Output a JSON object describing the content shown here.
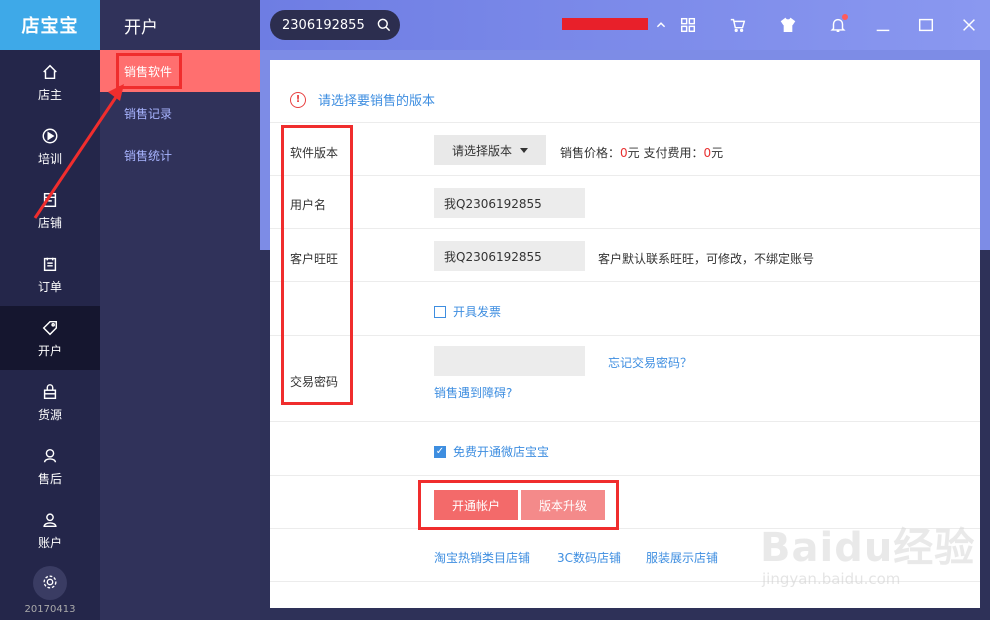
{
  "brand": "店宝宝",
  "rail": [
    {
      "label": "店主",
      "icon": "home-icon"
    },
    {
      "label": "培训",
      "icon": "play-icon"
    },
    {
      "label": "店铺",
      "icon": "store-icon"
    },
    {
      "label": "订单",
      "icon": "clipboard-icon"
    },
    {
      "label": "开户",
      "icon": "tag-icon"
    },
    {
      "label": "货源",
      "icon": "box-icon"
    },
    {
      "label": "售后",
      "icon": "headset-icon"
    },
    {
      "label": "账户",
      "icon": "user-icon"
    }
  ],
  "version": "20170413",
  "subnav": {
    "title": "开户",
    "items": [
      "销售软件",
      "销售记录",
      "销售统计"
    ]
  },
  "topbar": {
    "search_value": "2306192855",
    "icons": [
      "grid-icon",
      "cart-icon",
      "shirt-icon",
      "bell-icon",
      "minimize-icon",
      "maximize-icon",
      "close-icon"
    ]
  },
  "form": {
    "notice": "请选择要销售的版本",
    "version_label": "软件版本",
    "version_select": "请选择版本",
    "price_label": "销售价格：",
    "price_value": "0",
    "price_unit": "元",
    "pay_label": " 支付费用：",
    "pay_value": "0",
    "pay_unit": "元",
    "username_label": "用户名",
    "username_value": "我Q2306192855",
    "wangwang_label": "客户旺旺",
    "wangwang_value": "我Q2306192855",
    "wangwang_hint": "客户默认联系旺旺，可修改，不绑定账号",
    "invoice_label": "开具发票",
    "password_label": "交易密码",
    "forgot_link": "忘记交易密码？",
    "trouble_link": "销售遇到障碍?",
    "free_label": "免费开通微店宝宝",
    "open_button": "开通帐户",
    "upgrade_button": "版本升级",
    "shop_links": [
      "淘宝热销类目店铺",
      "3C数码店铺",
      "服装展示店铺"
    ]
  },
  "watermark": {
    "big": "Baidu经验",
    "small": "jingyan.baidu.com"
  },
  "colors": {
    "accent": "#3e8ee0",
    "danger": "#f36a6a",
    "annotation": "#f02d2d",
    "brand": "#3ea9e8"
  }
}
